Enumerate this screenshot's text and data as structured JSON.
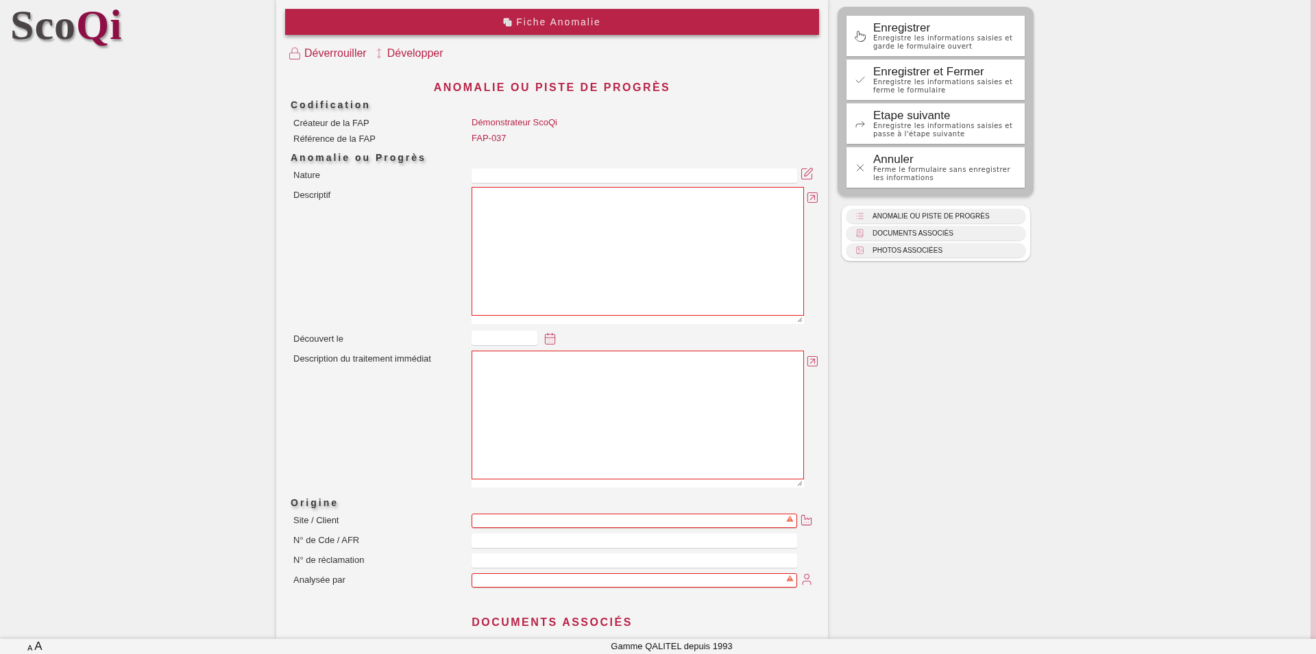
{
  "logo": [
    {
      "text": "Sco",
      "color": "#4a4446"
    },
    {
      "text": "Qi",
      "color": "#8e0f45"
    }
  ],
  "form_header": {
    "title": "Fiche Anomalie"
  },
  "toolbar": [
    "Déverrouiller",
    "Développer"
  ],
  "section_title": "ANOMALIE OU PISTE DE PROGRÈS",
  "groups": [
    {
      "title": "Codification",
      "fields": [
        {
          "kind": "readonly",
          "label": "Créateur de la FAP",
          "value": "Démonstrateur ScoQi"
        },
        {
          "kind": "readonly",
          "label": "Référence de la FAP",
          "value": "FAP-037"
        }
      ]
    },
    {
      "title": "Anomalie ou Progrès",
      "fields": [
        {
          "kind": "edit",
          "label": "Nature",
          "invalid": false
        },
        {
          "kind": "textarea",
          "label": "Descriptif",
          "invalid": true
        },
        {
          "kind": "date",
          "label": "Découvert le",
          "invalid": false
        },
        {
          "kind": "textarea",
          "label": "Description du traitement immédiat",
          "invalid": true
        }
      ]
    },
    {
      "title": "Origine",
      "fields": [
        {
          "kind": "site",
          "label": "Site / Client",
          "invalid": true
        },
        {
          "kind": "plain",
          "label": "N° de Cde / AFR",
          "invalid": false
        },
        {
          "kind": "plain",
          "label": "N° de réclamation",
          "invalid": false
        },
        {
          "kind": "person",
          "label": "Analysée par",
          "invalid": true
        }
      ]
    }
  ],
  "next_section_title": "DOCUMENTS ASSOCIÉS",
  "actions": [
    {
      "kind": "save",
      "title": "Enregistrer",
      "description": "Enregistre les informations saisies et garde le formulaire ouvert"
    },
    {
      "kind": "save_close",
      "title": "Enregistrer et Fermer",
      "description": "Enregistre les informations saisies et ferme le formulaire"
    },
    {
      "kind": "next",
      "title": "Etape suivante",
      "description": "Enregistre les informations saisies et passe à l'étape suivante"
    },
    {
      "kind": "cancel",
      "title": "Annuler",
      "description": "Ferme le formulaire sans enregistrer les informations"
    }
  ],
  "navigation": [
    {
      "kind": "list",
      "label": "ANOMALIE OU PISTE DE PROGRÈS"
    },
    {
      "kind": "documents",
      "label": "DOCUMENTS ASSOCIÉS"
    },
    {
      "kind": "photos",
      "label": "PHOTOS ASSOCIÉES"
    }
  ],
  "footer": {
    "font_small": "A",
    "font_large": "A",
    "text": "Gamme QALITEL depuis 1993"
  }
}
